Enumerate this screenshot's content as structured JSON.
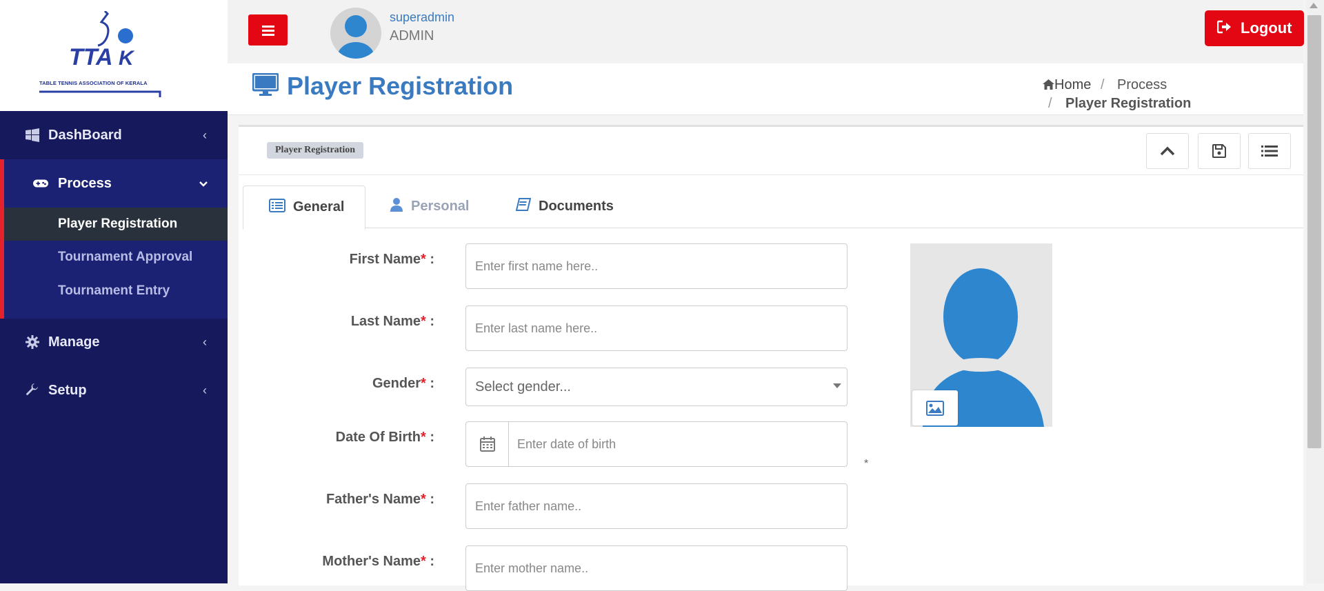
{
  "logo": {
    "tagline": "TABLE TENNIS ASSOCIATION OF KERALA",
    "wordmark": "TTAK"
  },
  "sidebar": {
    "items": [
      {
        "label": "DashBoard",
        "icon": "windows-icon",
        "chevron": "‹"
      },
      {
        "label": "Process",
        "icon": "gamepad-icon",
        "chevron": "⌄"
      },
      {
        "label": "Manage",
        "icon": "gear-icon",
        "chevron": "‹"
      },
      {
        "label": "Setup",
        "icon": "wrench-icon",
        "chevron": "‹"
      }
    ],
    "sub_items": [
      {
        "label": "Player Registration"
      },
      {
        "label": "Tournament Approval"
      },
      {
        "label": "Tournament Entry"
      }
    ]
  },
  "header": {
    "user_name": "superadmin",
    "user_role": "ADMIN",
    "logout_label": "Logout"
  },
  "page": {
    "title": "Player Registration",
    "breadcrumb": {
      "home": "Home",
      "separator": "/",
      "process": "Process",
      "current": "Player Registration"
    },
    "badge": "Player Registration"
  },
  "tabs": [
    {
      "label": "General",
      "icon": "list-icon"
    },
    {
      "label": "Personal",
      "icon": "user-icon"
    },
    {
      "label": "Documents",
      "icon": "book-icon"
    }
  ],
  "form": {
    "required_marker": "*",
    "label_suffix": " :",
    "fields": [
      {
        "label": "First Name",
        "placeholder": "Enter first name here.."
      },
      {
        "label": "Last Name",
        "placeholder": "Enter last name here.."
      },
      {
        "label": "Gender",
        "placeholder": "Select gender..."
      },
      {
        "label": "Date Of Birth",
        "placeholder": "Enter date of birth"
      },
      {
        "label": "Father's Name",
        "placeholder": "Enter father name.."
      },
      {
        "label": "Mother's Name",
        "placeholder": "Enter mother name.."
      }
    ],
    "photo_note": "*"
  },
  "colors": {
    "sidebar_bg": "#161a5c",
    "sidebar_active": "#1b2274",
    "accent_red": "#e30613",
    "brand_blue": "#3a7ac0"
  }
}
